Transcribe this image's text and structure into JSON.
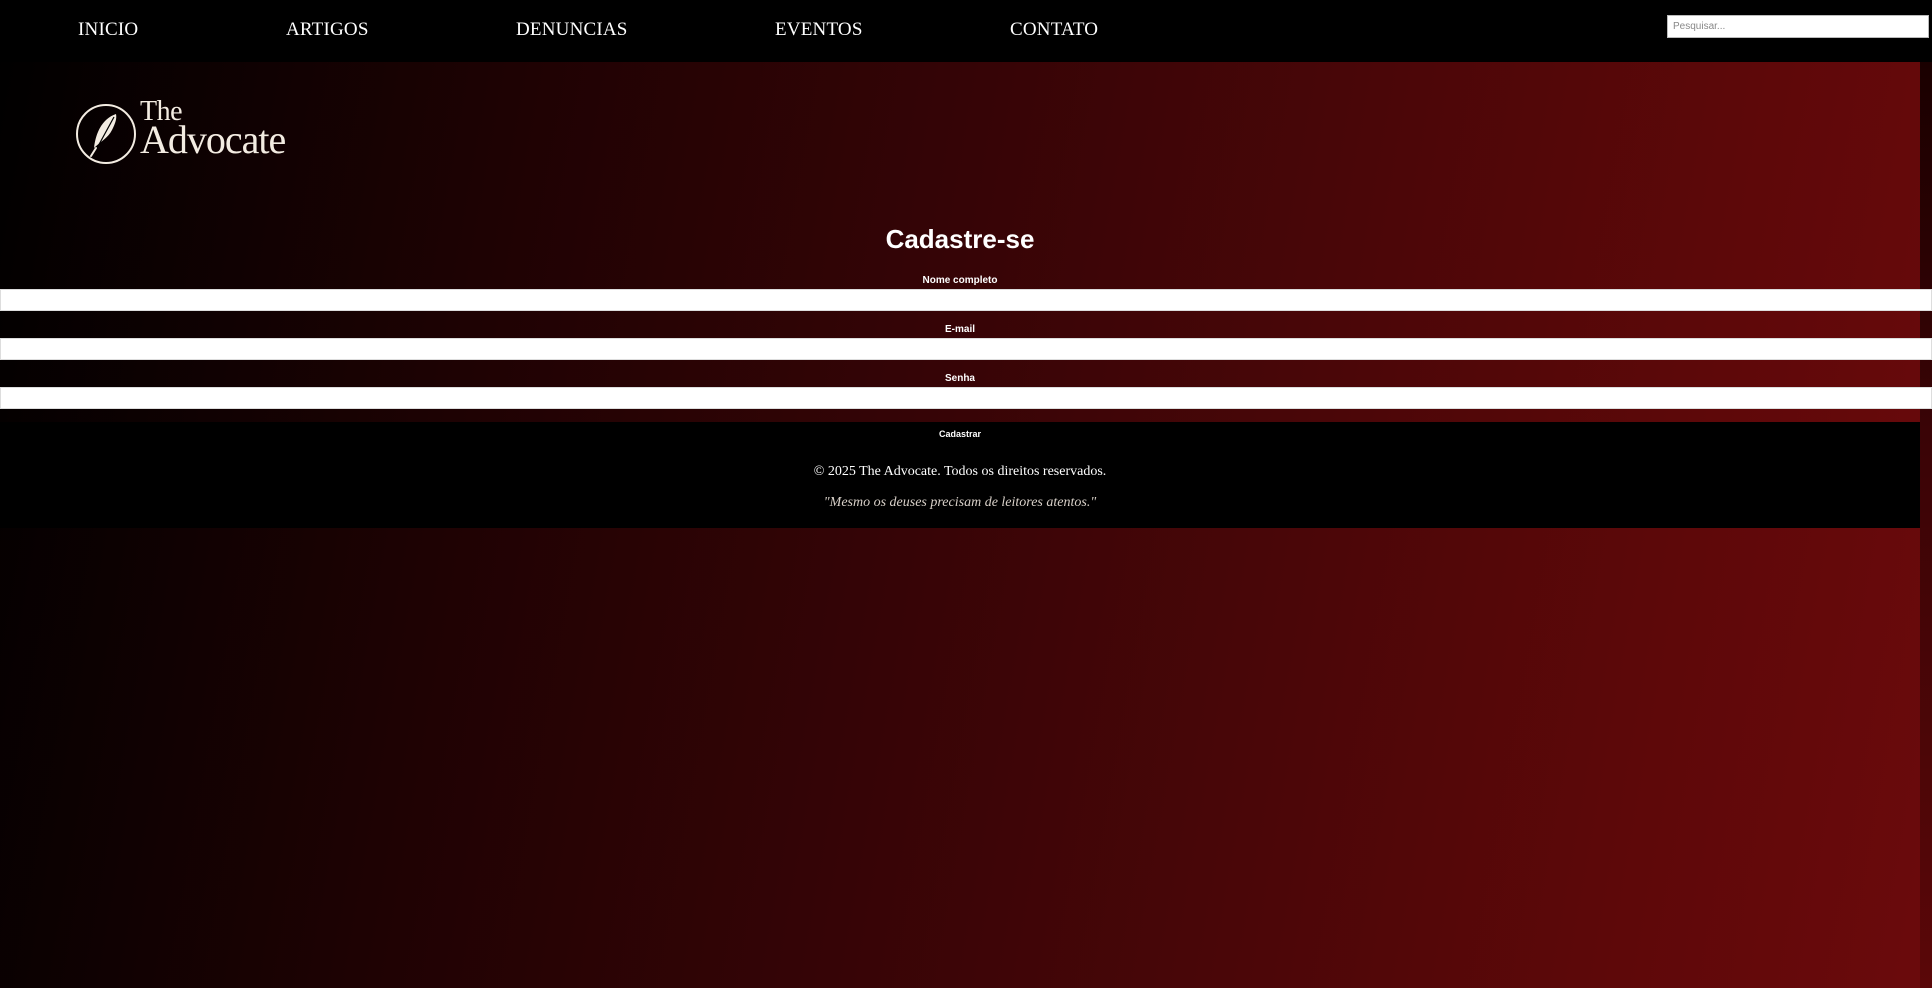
{
  "nav": {
    "items": [
      {
        "label": "INICIO"
      },
      {
        "label": "ARTIGOS"
      },
      {
        "label": "DENUNCIAS"
      },
      {
        "label": "EVENTOS"
      },
      {
        "label": "CONTATO"
      }
    ],
    "search_placeholder": "Pesquisar..."
  },
  "logo": {
    "line1": "The",
    "line2": "Advocate",
    "icon": "feather-quill-icon"
  },
  "form": {
    "title": "Cadastre-se",
    "fields": [
      {
        "label": "Nome completo",
        "value": ""
      },
      {
        "label": "E-mail",
        "value": ""
      },
      {
        "label": "Senha",
        "value": ""
      }
    ],
    "submit_label": "Cadastrar"
  },
  "footer": {
    "copyright": "© 2025 The Advocate. Todos os direitos reservados.",
    "quote": "\"Mesmo os deuses precisam de leitores atentos.\""
  },
  "colors": {
    "background_dark": "#000000",
    "background_red": "#6b0a0c",
    "logo_cream": "#f3ece2"
  }
}
